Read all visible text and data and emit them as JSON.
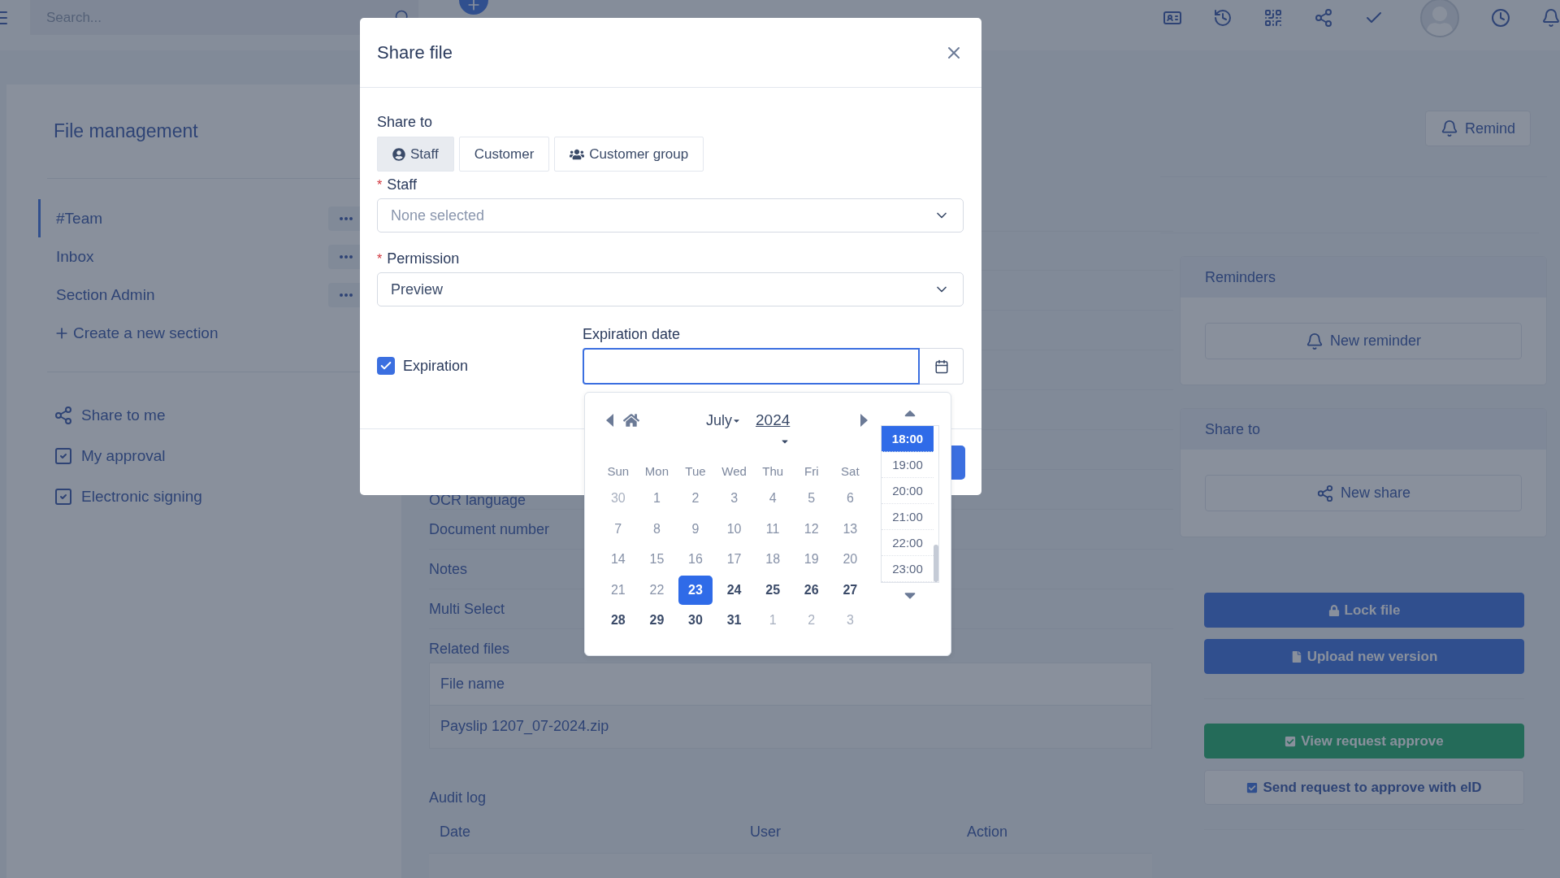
{
  "topbar": {
    "search": {
      "placeholder": "Search..."
    }
  },
  "sidebar": {
    "title": "File management",
    "sections": [
      {
        "label": "#Team",
        "selected": true
      },
      {
        "label": "Inbox",
        "selected": false
      },
      {
        "label": "Section Admin",
        "selected": false
      }
    ],
    "create_link": "Create a new section",
    "links": [
      {
        "kind": "share",
        "label": "Share to me"
      },
      {
        "kind": "check",
        "label": "My approval"
      },
      {
        "kind": "check",
        "label": "Electronic signing"
      }
    ]
  },
  "details": {
    "fields": [
      "OCR language",
      "Document number",
      "Notes",
      "Multi Select"
    ],
    "related_files": {
      "title": "Related files",
      "columns": [
        "File name"
      ],
      "rows": [
        "Payslip 1207_07-2024.zip"
      ]
    },
    "audit_log": {
      "title": "Audit log",
      "columns": [
        "Date",
        "User",
        "Action"
      ]
    }
  },
  "right_panel": {
    "remind_button": "Remind",
    "cards": [
      {
        "kind": "reminder",
        "title": "Reminders",
        "button": "New reminder"
      },
      {
        "kind": "share",
        "title": "Share to",
        "button": "New share"
      }
    ],
    "action_groups": [
      [
        {
          "kind": "lock",
          "label": "Lock file"
        },
        {
          "kind": "upload",
          "label": "Upload new version"
        }
      ],
      [
        {
          "kind": "view_approve",
          "label": "View request approve"
        },
        {
          "kind": "send_approve",
          "label": "Send request to approve with eID"
        }
      ]
    ]
  },
  "modal": {
    "title": "Share file",
    "share_to": {
      "label": "Share to",
      "options": [
        {
          "kind": "staff",
          "label": "Staff",
          "selected": true
        },
        {
          "kind": "customer",
          "label": "Customer",
          "selected": false
        },
        {
          "kind": "group",
          "label": "Customer group",
          "selected": false
        }
      ]
    },
    "staff": {
      "required_mark": "*",
      "label": "Staff",
      "placeholder": "None selected"
    },
    "permission": {
      "required_mark": "*",
      "label": "Permission",
      "value": "Preview"
    },
    "expiration": {
      "label": "Expiration",
      "checked": true
    },
    "expiration_date": {
      "label": "Expiration date"
    }
  },
  "date_picker": {
    "month": "July",
    "year": "2024",
    "weekdays": [
      "Sun",
      "Mon",
      "Tue",
      "Wed",
      "Thu",
      "Fri",
      "Sat"
    ],
    "weeks": [
      [
        {
          "day": "30",
          "kind": "outside",
          "selected": false
        },
        {
          "day": "1",
          "kind": "past",
          "selected": false
        },
        {
          "day": "2",
          "kind": "past",
          "selected": false
        },
        {
          "day": "3",
          "kind": "past",
          "selected": false
        },
        {
          "day": "4",
          "kind": "past",
          "selected": false
        },
        {
          "day": "5",
          "kind": "past",
          "selected": false
        },
        {
          "day": "6",
          "kind": "past",
          "selected": false
        }
      ],
      [
        {
          "day": "7",
          "kind": "past",
          "selected": false
        },
        {
          "day": "8",
          "kind": "past",
          "selected": false
        },
        {
          "day": "9",
          "kind": "past",
          "selected": false
        },
        {
          "day": "10",
          "kind": "past",
          "selected": false
        },
        {
          "day": "11",
          "kind": "past",
          "selected": false
        },
        {
          "day": "12",
          "kind": "past",
          "selected": false
        },
        {
          "day": "13",
          "kind": "past",
          "selected": false
        }
      ],
      [
        {
          "day": "14",
          "kind": "past",
          "selected": false
        },
        {
          "day": "15",
          "kind": "past",
          "selected": false
        },
        {
          "day": "16",
          "kind": "past",
          "selected": false
        },
        {
          "day": "17",
          "kind": "past",
          "selected": false
        },
        {
          "day": "18",
          "kind": "past",
          "selected": false
        },
        {
          "day": "19",
          "kind": "past",
          "selected": false
        },
        {
          "day": "20",
          "kind": "past",
          "selected": false
        }
      ],
      [
        {
          "day": "21",
          "kind": "past",
          "selected": false
        },
        {
          "day": "22",
          "kind": "past",
          "selected": false
        },
        {
          "day": "23",
          "kind": "current",
          "selected": true
        },
        {
          "day": "24",
          "kind": "current",
          "selected": false
        },
        {
          "day": "25",
          "kind": "current",
          "selected": false
        },
        {
          "day": "26",
          "kind": "current",
          "selected": false
        },
        {
          "day": "27",
          "kind": "current",
          "selected": false
        }
      ],
      [
        {
          "day": "28",
          "kind": "current",
          "selected": false
        },
        {
          "day": "29",
          "kind": "current",
          "selected": false
        },
        {
          "day": "30",
          "kind": "current",
          "selected": false
        },
        {
          "day": "31",
          "kind": "current",
          "selected": false
        },
        {
          "day": "1",
          "kind": "outside",
          "selected": false
        },
        {
          "day": "2",
          "kind": "outside",
          "selected": false
        },
        {
          "day": "3",
          "kind": "outside",
          "selected": false
        }
      ]
    ],
    "times": [
      {
        "label": "18:00",
        "selected": true
      },
      {
        "label": "19:00",
        "selected": false
      },
      {
        "label": "20:00",
        "selected": false
      },
      {
        "label": "21:00",
        "selected": false
      },
      {
        "label": "22:00",
        "selected": false
      },
      {
        "label": "23:00",
        "selected": false
      }
    ]
  }
}
